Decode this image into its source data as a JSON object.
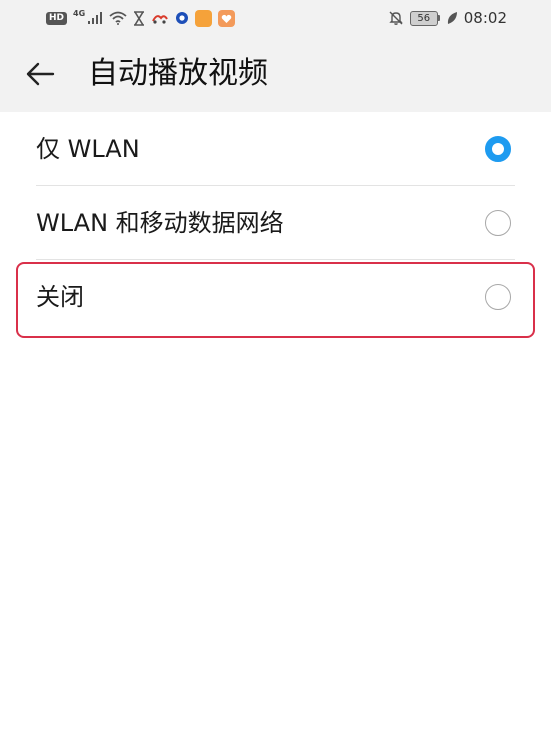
{
  "status_bar": {
    "hd_badge": "HD",
    "network_label": "4G",
    "battery_level": "56",
    "time": "08:02",
    "icons": [
      "hd-badge",
      "signal-icon",
      "wifi-icon",
      "hourglass-icon",
      "app-icon",
      "circle-app-icon",
      "orange-app-icon",
      "orange-heart-app-icon",
      "notifications-off-icon",
      "battery-icon",
      "leaf-icon"
    ],
    "colors": {
      "orange_app": "#f5a23a",
      "orange_heart_app": "#f39a5a",
      "circle_app": "#1d4fb8",
      "red_app": "#d93b2b"
    }
  },
  "header": {
    "title": "自动播放视频",
    "back_icon": "arrow-left-icon"
  },
  "options": [
    {
      "label": "仅 WLAN",
      "selected": true
    },
    {
      "label": "WLAN 和移动数据网络",
      "selected": false
    },
    {
      "label": "关闭",
      "selected": false
    }
  ],
  "colors": {
    "accent": "#1e9bf0",
    "highlight_border": "#d9304a",
    "header_bg": "#f2f2f2"
  }
}
